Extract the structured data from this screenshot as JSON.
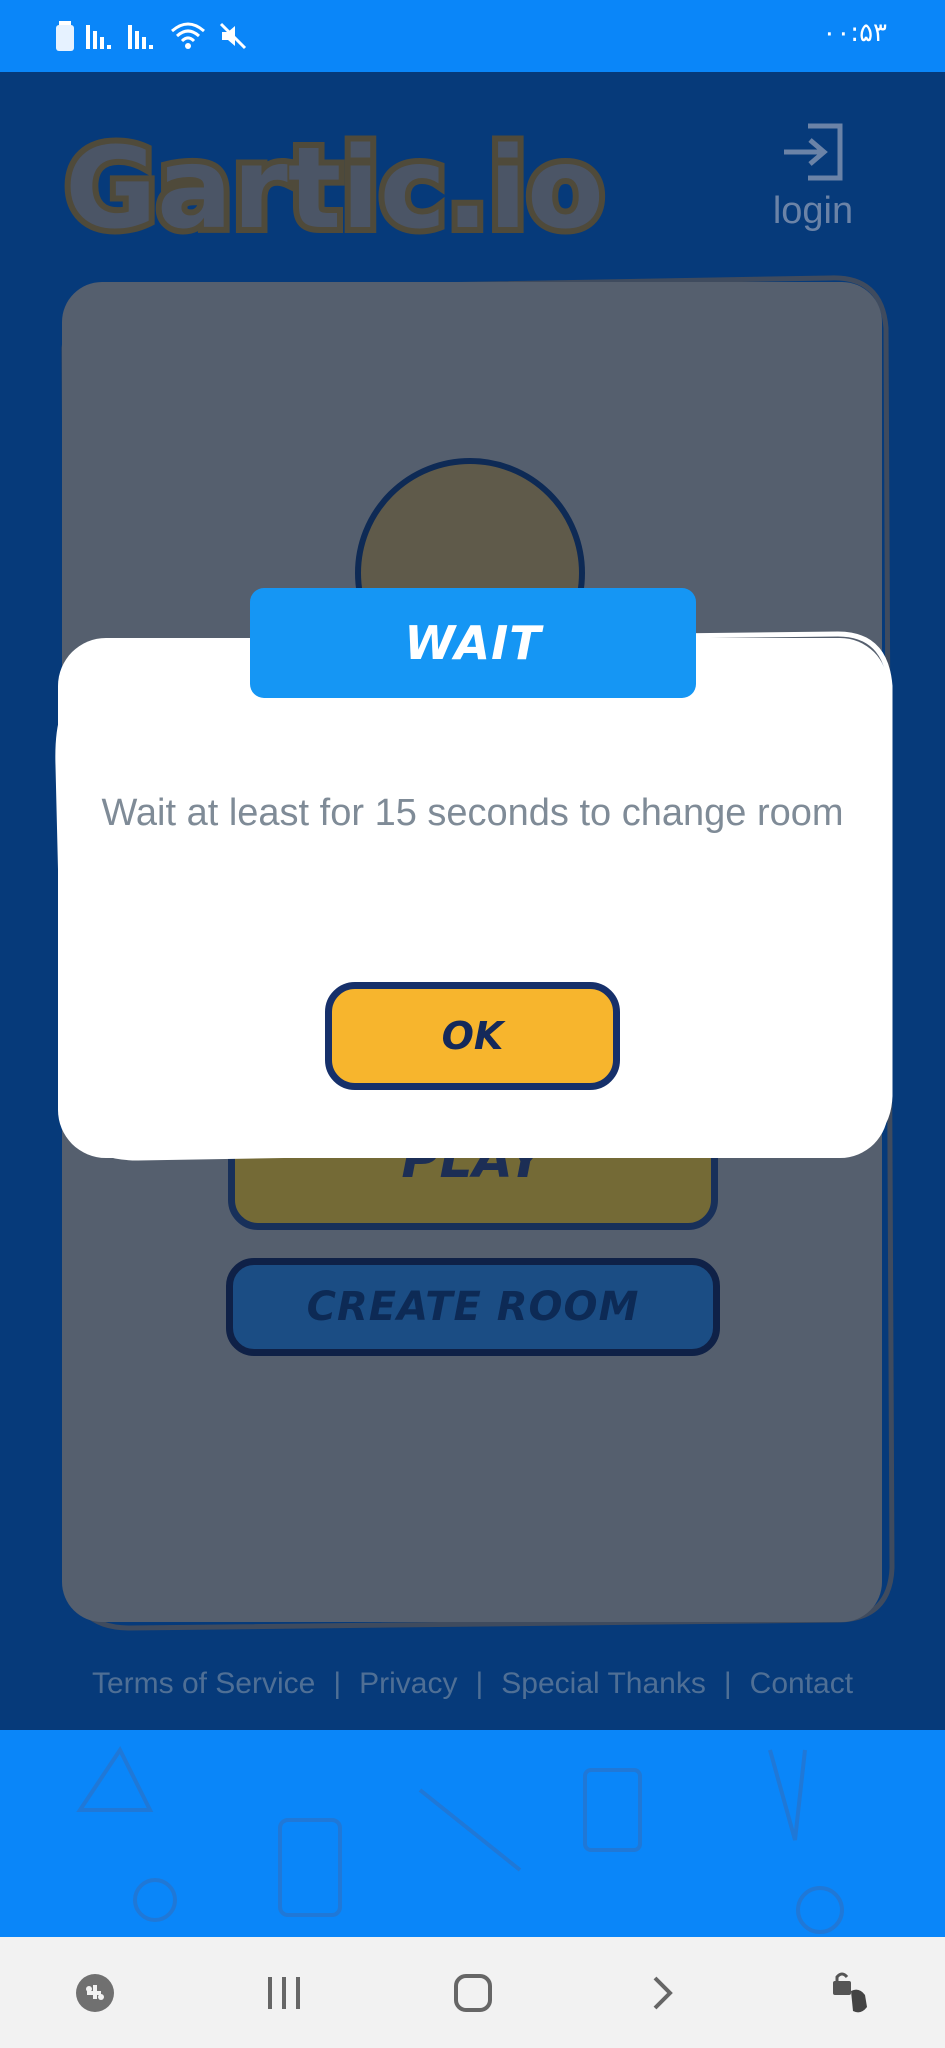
{
  "status_bar": {
    "time": "۰۰:۵۳",
    "icons": [
      "battery-icon",
      "signal-icon",
      "signal-icon",
      "wifi-icon",
      "mute-icon"
    ]
  },
  "header": {
    "logo_text": "Gartic.io",
    "login_label": "login",
    "login_icon": "login-arrow-icon"
  },
  "main": {
    "play_label": "PLAY",
    "create_room_label": "CREATE ROOM"
  },
  "footer": {
    "links": [
      "Terms of Service",
      "Privacy",
      "Special Thanks",
      "Contact"
    ]
  },
  "modal": {
    "title": "WAIT",
    "message": "Wait at least for 15 seconds to change room",
    "ok_label": "OK"
  },
  "navbar": {
    "buttons": [
      "game-launcher-icon",
      "recent-apps-icon",
      "home-icon",
      "back-icon",
      "touch-lock-icon"
    ]
  },
  "colors": {
    "status_bar": "#0a86f9",
    "dim_background": "#063a7a",
    "card": "#555f6e",
    "modal_title": "#1596f4",
    "ok_button": "#f7b52d",
    "button_border": "#16306a"
  }
}
